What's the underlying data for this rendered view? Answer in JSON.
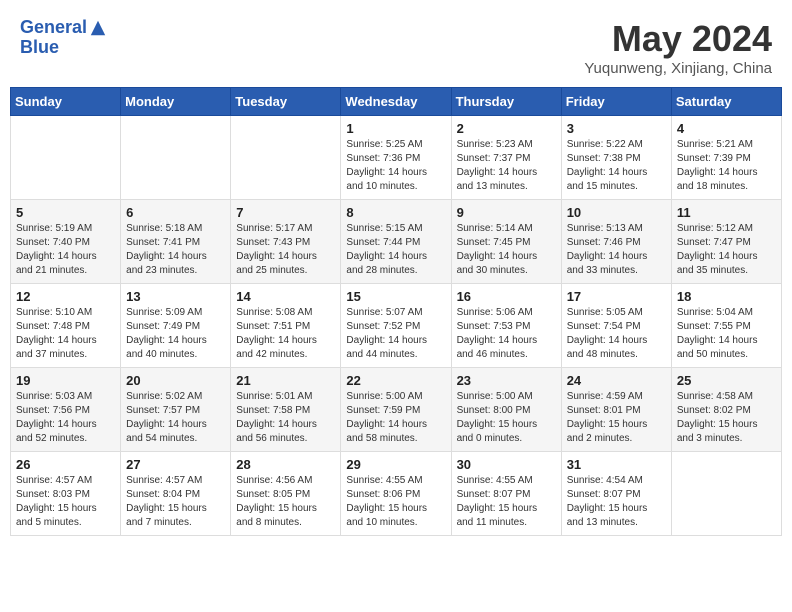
{
  "header": {
    "logo_line1": "General",
    "logo_line2": "Blue",
    "month": "May 2024",
    "location": "Yuqunweng, Xinjiang, China"
  },
  "weekdays": [
    "Sunday",
    "Monday",
    "Tuesday",
    "Wednesday",
    "Thursday",
    "Friday",
    "Saturday"
  ],
  "weeks": [
    [
      {
        "day": "",
        "sunrise": "",
        "sunset": "",
        "daylight": ""
      },
      {
        "day": "",
        "sunrise": "",
        "sunset": "",
        "daylight": ""
      },
      {
        "day": "",
        "sunrise": "",
        "sunset": "",
        "daylight": ""
      },
      {
        "day": "1",
        "sunrise": "5:25 AM",
        "sunset": "7:36 PM",
        "daylight": "14 hours and 10 minutes."
      },
      {
        "day": "2",
        "sunrise": "5:23 AM",
        "sunset": "7:37 PM",
        "daylight": "14 hours and 13 minutes."
      },
      {
        "day": "3",
        "sunrise": "5:22 AM",
        "sunset": "7:38 PM",
        "daylight": "14 hours and 15 minutes."
      },
      {
        "day": "4",
        "sunrise": "5:21 AM",
        "sunset": "7:39 PM",
        "daylight": "14 hours and 18 minutes."
      }
    ],
    [
      {
        "day": "5",
        "sunrise": "5:19 AM",
        "sunset": "7:40 PM",
        "daylight": "14 hours and 21 minutes."
      },
      {
        "day": "6",
        "sunrise": "5:18 AM",
        "sunset": "7:41 PM",
        "daylight": "14 hours and 23 minutes."
      },
      {
        "day": "7",
        "sunrise": "5:17 AM",
        "sunset": "7:43 PM",
        "daylight": "14 hours and 25 minutes."
      },
      {
        "day": "8",
        "sunrise": "5:15 AM",
        "sunset": "7:44 PM",
        "daylight": "14 hours and 28 minutes."
      },
      {
        "day": "9",
        "sunrise": "5:14 AM",
        "sunset": "7:45 PM",
        "daylight": "14 hours and 30 minutes."
      },
      {
        "day": "10",
        "sunrise": "5:13 AM",
        "sunset": "7:46 PM",
        "daylight": "14 hours and 33 minutes."
      },
      {
        "day": "11",
        "sunrise": "5:12 AM",
        "sunset": "7:47 PM",
        "daylight": "14 hours and 35 minutes."
      }
    ],
    [
      {
        "day": "12",
        "sunrise": "5:10 AM",
        "sunset": "7:48 PM",
        "daylight": "14 hours and 37 minutes."
      },
      {
        "day": "13",
        "sunrise": "5:09 AM",
        "sunset": "7:49 PM",
        "daylight": "14 hours and 40 minutes."
      },
      {
        "day": "14",
        "sunrise": "5:08 AM",
        "sunset": "7:51 PM",
        "daylight": "14 hours and 42 minutes."
      },
      {
        "day": "15",
        "sunrise": "5:07 AM",
        "sunset": "7:52 PM",
        "daylight": "14 hours and 44 minutes."
      },
      {
        "day": "16",
        "sunrise": "5:06 AM",
        "sunset": "7:53 PM",
        "daylight": "14 hours and 46 minutes."
      },
      {
        "day": "17",
        "sunrise": "5:05 AM",
        "sunset": "7:54 PM",
        "daylight": "14 hours and 48 minutes."
      },
      {
        "day": "18",
        "sunrise": "5:04 AM",
        "sunset": "7:55 PM",
        "daylight": "14 hours and 50 minutes."
      }
    ],
    [
      {
        "day": "19",
        "sunrise": "5:03 AM",
        "sunset": "7:56 PM",
        "daylight": "14 hours and 52 minutes."
      },
      {
        "day": "20",
        "sunrise": "5:02 AM",
        "sunset": "7:57 PM",
        "daylight": "14 hours and 54 minutes."
      },
      {
        "day": "21",
        "sunrise": "5:01 AM",
        "sunset": "7:58 PM",
        "daylight": "14 hours and 56 minutes."
      },
      {
        "day": "22",
        "sunrise": "5:00 AM",
        "sunset": "7:59 PM",
        "daylight": "14 hours and 58 minutes."
      },
      {
        "day": "23",
        "sunrise": "5:00 AM",
        "sunset": "8:00 PM",
        "daylight": "15 hours and 0 minutes."
      },
      {
        "day": "24",
        "sunrise": "4:59 AM",
        "sunset": "8:01 PM",
        "daylight": "15 hours and 2 minutes."
      },
      {
        "day": "25",
        "sunrise": "4:58 AM",
        "sunset": "8:02 PM",
        "daylight": "15 hours and 3 minutes."
      }
    ],
    [
      {
        "day": "26",
        "sunrise": "4:57 AM",
        "sunset": "8:03 PM",
        "daylight": "15 hours and 5 minutes."
      },
      {
        "day": "27",
        "sunrise": "4:57 AM",
        "sunset": "8:04 PM",
        "daylight": "15 hours and 7 minutes."
      },
      {
        "day": "28",
        "sunrise": "4:56 AM",
        "sunset": "8:05 PM",
        "daylight": "15 hours and 8 minutes."
      },
      {
        "day": "29",
        "sunrise": "4:55 AM",
        "sunset": "8:06 PM",
        "daylight": "15 hours and 10 minutes."
      },
      {
        "day": "30",
        "sunrise": "4:55 AM",
        "sunset": "8:07 PM",
        "daylight": "15 hours and 11 minutes."
      },
      {
        "day": "31",
        "sunrise": "4:54 AM",
        "sunset": "8:07 PM",
        "daylight": "15 hours and 13 minutes."
      },
      {
        "day": "",
        "sunrise": "",
        "sunset": "",
        "daylight": ""
      }
    ]
  ]
}
